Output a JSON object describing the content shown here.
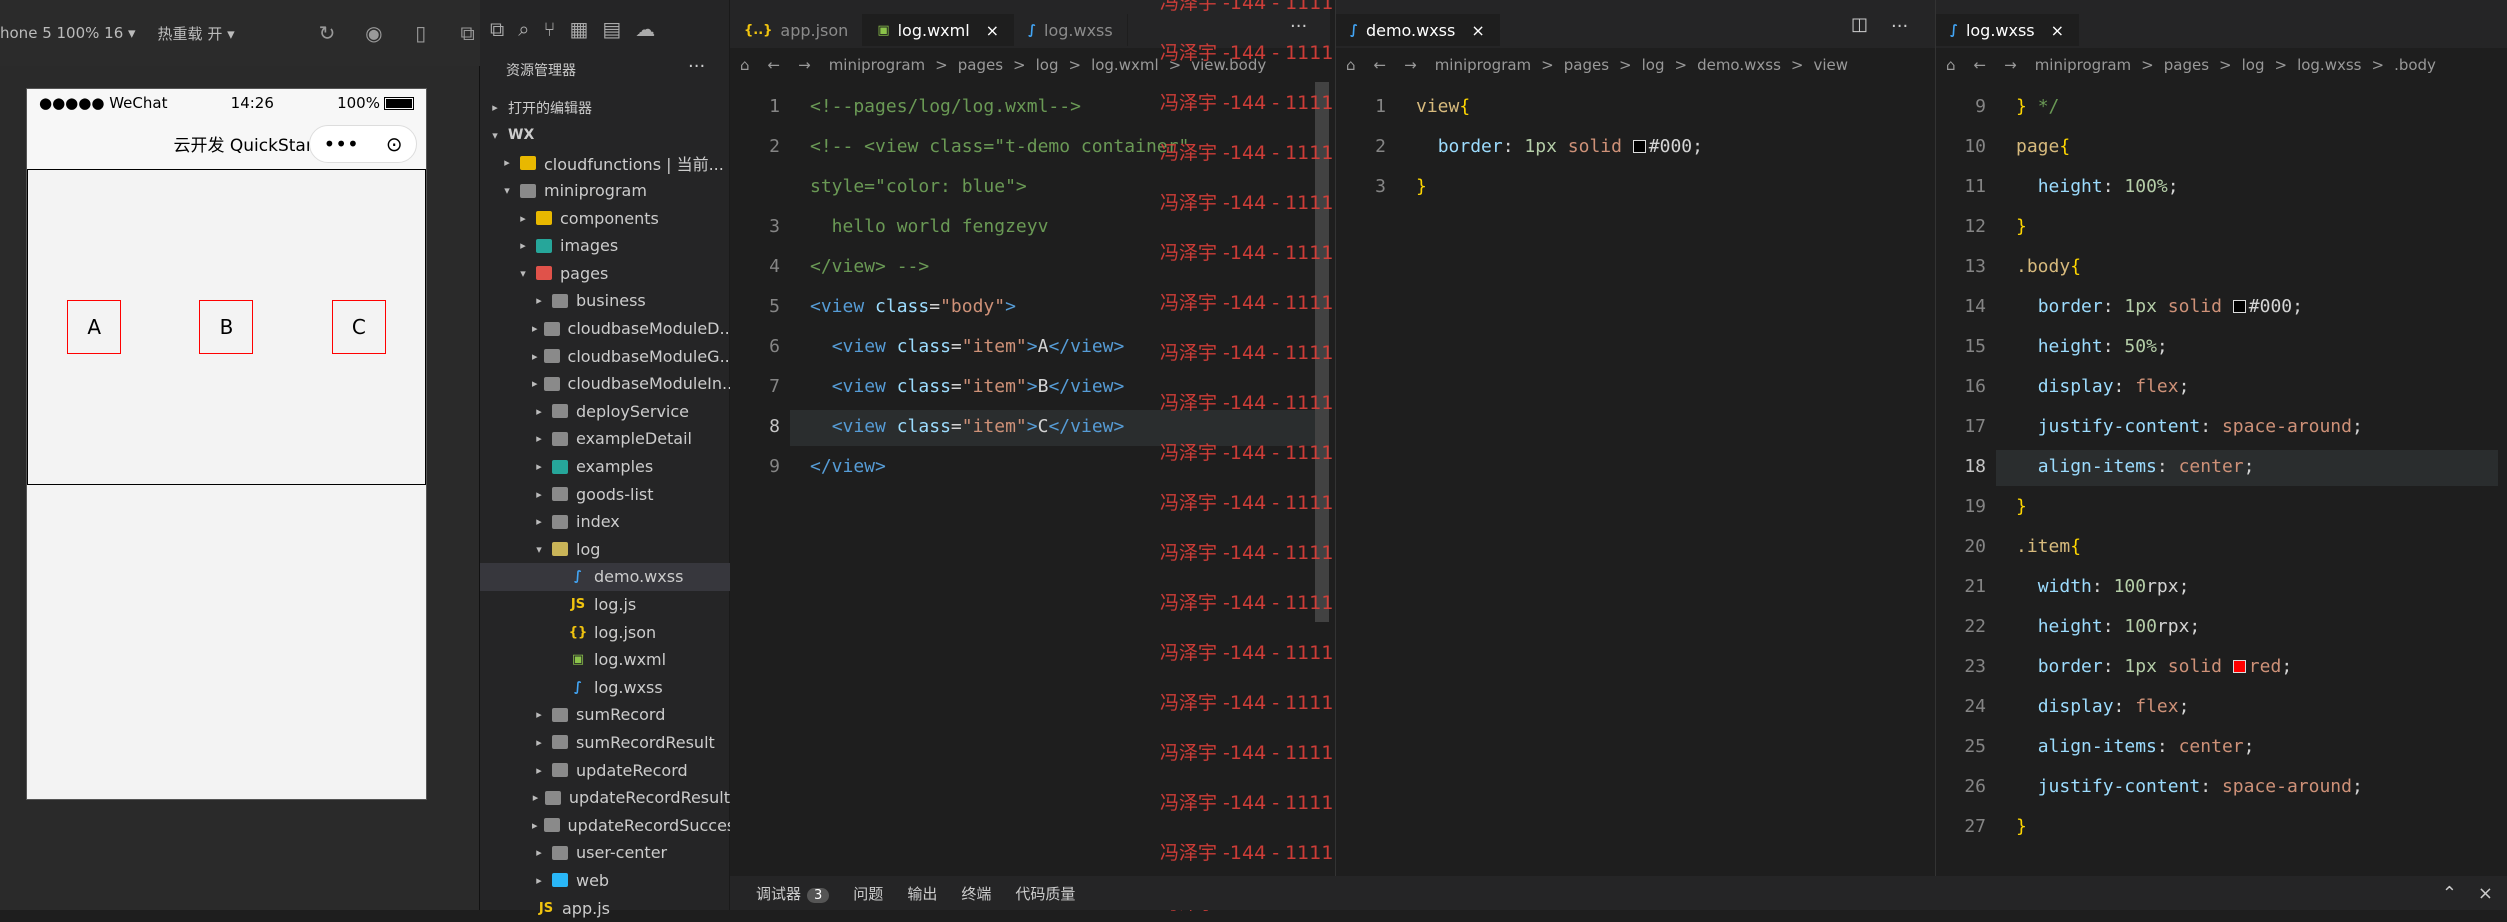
{
  "simulator": {
    "device_label": "hone 5 100% 16 ▾",
    "hot_reload": "热重载 开 ▾",
    "status": {
      "carrier": "●●●●● WeChat",
      "time": "14:26",
      "battery": "100%"
    },
    "nav_title": "云开发 QuickStart",
    "capsule_more": "•••",
    "capsule_close": "⊙",
    "items": [
      "A",
      "B",
      "C"
    ]
  },
  "explorer": {
    "title": "资源管理器",
    "more": "···",
    "open_editors": "打开的编辑器",
    "root": "WX",
    "rows": [
      {
        "label": "cloudfunctions | 当前...",
        "depth": 1,
        "tw": "▸",
        "type": "folder",
        "color": "#e8b800"
      },
      {
        "label": "miniprogram",
        "depth": 1,
        "tw": "▾",
        "type": "folder",
        "color": "#8a8a8a"
      },
      {
        "label": "components",
        "depth": 2,
        "tw": "▸",
        "type": "folder",
        "color": "#e8b800"
      },
      {
        "label": "images",
        "depth": 2,
        "tw": "▸",
        "type": "folder",
        "color": "#26a69a"
      },
      {
        "label": "pages",
        "depth": 2,
        "tw": "▾",
        "type": "folder",
        "color": "#e0524a"
      },
      {
        "label": "business",
        "depth": 3,
        "tw": "▸",
        "type": "folder",
        "color": "#8a8a8a"
      },
      {
        "label": "cloudbaseModuleD...",
        "depth": 3,
        "tw": "▸",
        "type": "folder",
        "color": "#8a8a8a"
      },
      {
        "label": "cloudbaseModuleG...",
        "depth": 3,
        "tw": "▸",
        "type": "folder",
        "color": "#8a8a8a"
      },
      {
        "label": "cloudbaseModuleIn...",
        "depth": 3,
        "tw": "▸",
        "type": "folder",
        "color": "#8a8a8a"
      },
      {
        "label": "deployService",
        "depth": 3,
        "tw": "▸",
        "type": "folder",
        "color": "#8a8a8a"
      },
      {
        "label": "exampleDetail",
        "depth": 3,
        "tw": "▸",
        "type": "folder",
        "color": "#8a8a8a"
      },
      {
        "label": "examples",
        "depth": 3,
        "tw": "▸",
        "type": "folder",
        "color": "#26a69a"
      },
      {
        "label": "goods-list",
        "depth": 3,
        "tw": "▸",
        "type": "folder",
        "color": "#8a8a8a"
      },
      {
        "label": "index",
        "depth": 3,
        "tw": "▸",
        "type": "folder",
        "color": "#8a8a8a"
      },
      {
        "label": "log",
        "depth": 3,
        "tw": "▾",
        "type": "folder",
        "color": "#c9b458"
      },
      {
        "label": "demo.wxss",
        "depth": 4,
        "tw": "",
        "type": "wxss",
        "color": "#42a5f5",
        "selected": true
      },
      {
        "label": "log.js",
        "depth": 4,
        "tw": "",
        "type": "js",
        "color": "#f1c40f"
      },
      {
        "label": "log.json",
        "depth": 4,
        "tw": "",
        "type": "json",
        "color": "#f1c40f"
      },
      {
        "label": "log.wxml",
        "depth": 4,
        "tw": "",
        "type": "wxml",
        "color": "#8bc34a"
      },
      {
        "label": "log.wxss",
        "depth": 4,
        "tw": "",
        "type": "wxss",
        "color": "#42a5f5"
      },
      {
        "label": "sumRecord",
        "depth": 3,
        "tw": "▸",
        "type": "folder",
        "color": "#8a8a8a"
      },
      {
        "label": "sumRecordResult",
        "depth": 3,
        "tw": "▸",
        "type": "folder",
        "color": "#8a8a8a"
      },
      {
        "label": "updateRecord",
        "depth": 3,
        "tw": "▸",
        "type": "folder",
        "color": "#8a8a8a"
      },
      {
        "label": "updateRecordResult",
        "depth": 3,
        "tw": "▸",
        "type": "folder",
        "color": "#8a8a8a"
      },
      {
        "label": "updateRecordSuccess",
        "depth": 3,
        "tw": "▸",
        "type": "folder",
        "color": "#8a8a8a"
      },
      {
        "label": "user-center",
        "depth": 3,
        "tw": "▸",
        "type": "folder",
        "color": "#8a8a8a"
      },
      {
        "label": "web",
        "depth": 3,
        "tw": "▸",
        "type": "folder",
        "color": "#29b6f6"
      },
      {
        "label": "app.js",
        "depth": 2,
        "tw": "",
        "type": "js",
        "color": "#f1c40f"
      }
    ]
  },
  "editor1": {
    "tabs": [
      {
        "label": "app.json",
        "icon": "{..}"
      },
      {
        "label": "log.wxml",
        "icon": "▣",
        "active": true,
        "close": "×"
      },
      {
        "label": "log.wxss",
        "icon": "∫"
      }
    ],
    "more": "···",
    "crumbs": [
      "miniprogram",
      ">",
      "pages",
      ">",
      "log",
      ">",
      "log.wxml",
      ">",
      "view.body"
    ],
    "lines": [
      {
        "n": "1",
        "html": "<span class='c-com'>&lt;!--pages/log/log.wxml--&gt;</span>"
      },
      {
        "n": "2",
        "html": "<span class='c-com'>&lt;!-- &lt;view class=\"t-demo container\"</span>"
      },
      {
        "n": "",
        "html": "<span class='c-com'>style=\"color: blue\"&gt;</span>"
      },
      {
        "n": "3",
        "html": "<span class='c-com'>  hello world fengzeyv</span>"
      },
      {
        "n": "4",
        "html": "<span class='c-com'>&lt;/view&gt; --&gt;</span>"
      },
      {
        "n": "5",
        "html": "<span class='c-tag'>&lt;view</span> <span class='c-att'>class</span>=<span class='c-str'>\"body\"</span><span class='c-tag'>&gt;</span>"
      },
      {
        "n": "6",
        "html": "  <span class='c-tag'>&lt;view</span> <span class='c-att'>class</span>=<span class='c-str'>\"item\"</span><span class='c-tag'>&gt;</span>A<span class='c-tag'>&lt;/view&gt;</span>"
      },
      {
        "n": "7",
        "html": "  <span class='c-tag'>&lt;view</span> <span class='c-att'>class</span>=<span class='c-str'>\"item\"</span><span class='c-tag'>&gt;</span>B<span class='c-tag'>&lt;/view&gt;</span>"
      },
      {
        "n": "8",
        "html": "  <span class='c-tag'>&lt;view</span> <span class='c-att'>class</span>=<span class='c-str'>\"item\"</span><span class='c-tag'>&gt;</span>C<span class='c-tag'>&lt;/view&gt;</span>"
      },
      {
        "n": "9",
        "html": "<span class='c-tag'>&lt;/view&gt;</span>"
      }
    ]
  },
  "editor2": {
    "tabs": [
      {
        "label": "demo.wxss",
        "icon": "∫",
        "active": true,
        "close": "×"
      }
    ],
    "more": "···",
    "crumbs": [
      "miniprogram",
      ">",
      "pages",
      ">",
      "log",
      ">",
      "demo.wxss",
      ">",
      "view"
    ],
    "lines": [
      {
        "n": "1",
        "html": "<span class='c-sel'>view</span><span class='c-br'>{</span>"
      },
      {
        "n": "2",
        "html": "  <span class='c-prop'>border</span>: <span class='c-num'>1px</span> <span class='c-str'>solid</span> <span class='sw' style='background:#000'></span>#000;"
      },
      {
        "n": "3",
        "html": "<span class='c-br'>}</span>"
      }
    ]
  },
  "editor3": {
    "tabs": [
      {
        "label": "log.wxss",
        "icon": "∫",
        "active": true,
        "close": "×"
      }
    ],
    "crumbs": [
      "miniprogram",
      ">",
      "pages",
      ">",
      "log",
      ">",
      "log.wxss",
      ">",
      ".body"
    ],
    "lines": [
      {
        "n": "9",
        "html": "<span class='c-br'>}</span> <span class='c-com'>*/</span>"
      },
      {
        "n": "10",
        "html": "<span class='c-sel'>page</span><span class='c-br'>{</span>"
      },
      {
        "n": "11",
        "html": "  <span class='c-prop'>height</span>: <span class='c-num'>100%</span>;"
      },
      {
        "n": "12",
        "html": "<span class='c-br'>}</span>"
      },
      {
        "n": "13",
        "html": "<span class='c-sel'>.body</span><span class='c-br'>{</span>"
      },
      {
        "n": "14",
        "html": "  <span class='c-prop'>border</span>: <span class='c-num'>1px</span> <span class='c-str'>solid</span> <span class='sw' style='background:#000'></span>#000;"
      },
      {
        "n": "15",
        "html": "  <span class='c-prop'>height</span>: <span class='c-num'>50%</span>;"
      },
      {
        "n": "16",
        "html": "  <span class='c-prop'>display</span>: <span class='c-str'>flex</span>;"
      },
      {
        "n": "17",
        "html": "  <span class='c-prop'>justify-content</span>: <span class='c-str'>space-around</span>;"
      },
      {
        "n": "18",
        "html": "  <span class='c-prop'>align-items</span>: <span class='c-str'>center</span>;"
      },
      {
        "n": "19",
        "html": "<span class='c-br'>}</span>"
      },
      {
        "n": "20",
        "html": "<span class='c-sel'>.item</span><span class='c-br'>{</span>"
      },
      {
        "n": "21",
        "html": "  <span class='c-prop'>width</span>: <span class='c-num'>100</span>rpx;"
      },
      {
        "n": "22",
        "html": "  <span class='c-prop'>height</span>: <span class='c-num'>100</span>rpx;"
      },
      {
        "n": "23",
        "html": "  <span class='c-prop'>border</span>: <span class='c-num'>1px</span> <span class='c-str'>solid</span> <span class='sw' style='background:red'></span><span class='c-str'>red</span>;"
      },
      {
        "n": "24",
        "html": "  <span class='c-prop'>display</span>: <span class='c-str'>flex</span>;"
      },
      {
        "n": "25",
        "html": "  <span class='c-prop'>align-items</span>: <span class='c-str'>center</span>;"
      },
      {
        "n": "26",
        "html": "  <span class='c-prop'>justify-content</span>: <span class='c-str'>space-around</span>;"
      },
      {
        "n": "27",
        "html": "<span class='c-br'>}</span>"
      }
    ]
  },
  "watermark": "冯泽宇 -144 - 1111",
  "bottom": {
    "tabs": [
      "调试器",
      "问题",
      "输出",
      "终端",
      "代码质量"
    ],
    "badge": "3"
  }
}
